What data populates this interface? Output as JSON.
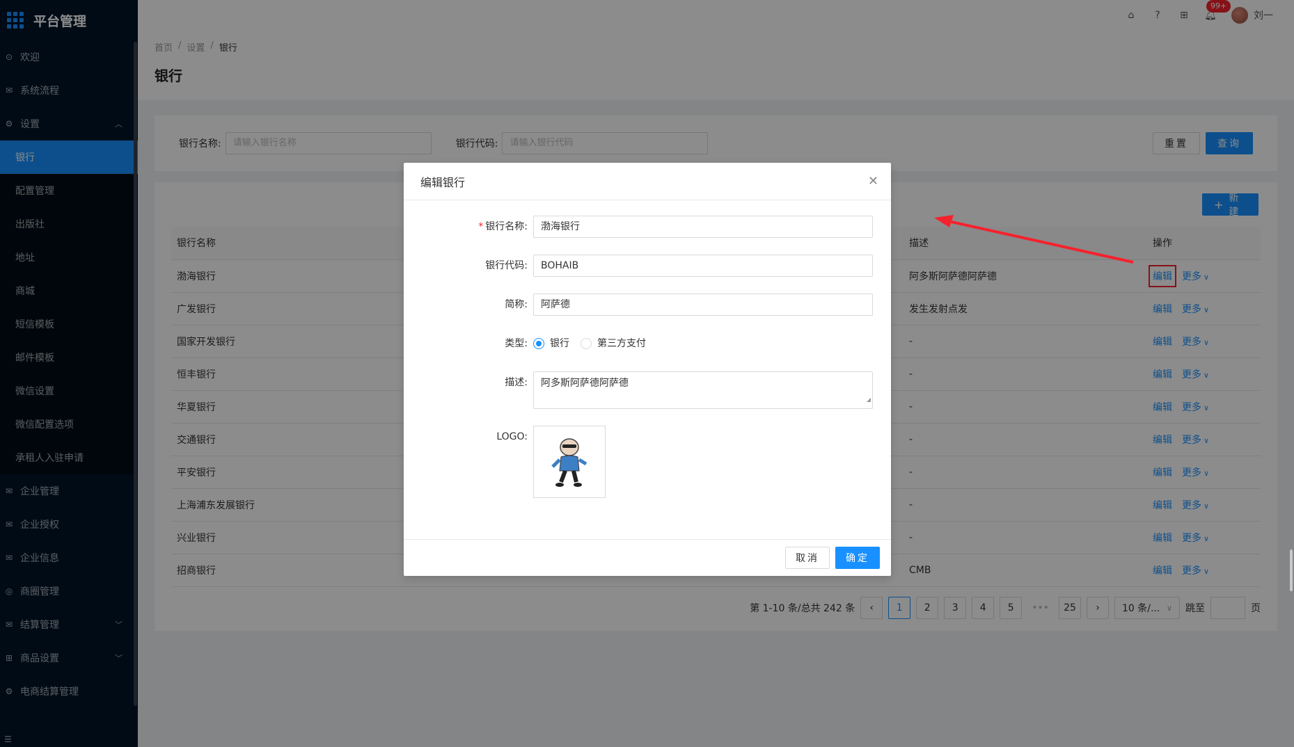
{
  "app": {
    "title": "平台管理"
  },
  "sidebar": {
    "items": [
      {
        "label": "欢迎",
        "icon": "check-circle-icon"
      },
      {
        "label": "系统流程",
        "icon": "mail-icon"
      },
      {
        "label": "设置",
        "icon": "gear-icon"
      }
    ],
    "settings_sub": [
      "银行",
      "配置管理",
      "出版社",
      "地址",
      "商城",
      "短信模板",
      "邮件模板",
      "微信设置",
      "微信配置选项",
      "承租人入驻申请"
    ],
    "items_after": [
      {
        "label": "企业管理",
        "icon": "mail-icon"
      },
      {
        "label": "企业授权",
        "icon": "mail-icon"
      },
      {
        "label": "企业信息",
        "icon": "mail-icon"
      },
      {
        "label": "商圈管理",
        "icon": "compass-icon"
      },
      {
        "label": "结算管理",
        "icon": "mail-icon"
      },
      {
        "label": "商品设置",
        "icon": "grid-icon"
      },
      {
        "label": "电商结算管理",
        "icon": "gear-icon"
      }
    ]
  },
  "header": {
    "badge": "99+",
    "user": "刘一"
  },
  "breadcrumb": [
    "首页",
    "设置",
    "银行"
  ],
  "page_title": "银行",
  "search": {
    "bank_name_label": "银行名称:",
    "bank_name_placeholder": "请输入银行名称",
    "bank_code_label": "银行代码:",
    "bank_code_placeholder": "请输入银行代码",
    "reset": "重置",
    "query": "查询"
  },
  "table": {
    "new_button": "新建",
    "columns": [
      "银行名称",
      "描述",
      "操作"
    ],
    "rows": [
      {
        "name": "渤海银行",
        "desc": "阿多斯阿萨德阿萨德"
      },
      {
        "name": "广发银行",
        "desc": "发生发射点发"
      },
      {
        "name": "国家开发银行",
        "desc": "-"
      },
      {
        "name": "恒丰银行",
        "desc": "-"
      },
      {
        "name": "华夏银行",
        "desc": "-"
      },
      {
        "name": "交通银行",
        "desc": "-"
      },
      {
        "name": "平安银行",
        "desc": "-"
      },
      {
        "name": "上海浦东发展银行",
        "desc": "-"
      },
      {
        "name": "兴业银行",
        "desc": "-"
      },
      {
        "name": "招商银行",
        "desc": "CMB"
      }
    ],
    "edit": "编辑",
    "more": "更多"
  },
  "pagination": {
    "summary": "第 1-10 条/总共 242 条",
    "pages": [
      "1",
      "2",
      "3",
      "4",
      "5",
      "25"
    ],
    "ellipsis": "•••",
    "page_size": "10 条/...",
    "jump_label": "跳至",
    "page_unit": "页"
  },
  "modal": {
    "title": "编辑银行",
    "fields": {
      "name_label": "银行名称:",
      "name_value": "渤海银行",
      "code_label": "银行代码:",
      "code_value": "BOHAIB",
      "short_label": "简称:",
      "short_value": "阿萨德",
      "type_label": "类型:",
      "type_options": [
        "银行",
        "第三方支付"
      ],
      "desc_label": "描述:",
      "desc_value": "阿多斯阿萨德阿萨德",
      "logo_label": "LOGO:"
    },
    "cancel": "取消",
    "ok": "确定"
  },
  "colors": {
    "primary": "#1890ff",
    "sidebar_bg": "#001529",
    "highlight": "#f5222d"
  }
}
